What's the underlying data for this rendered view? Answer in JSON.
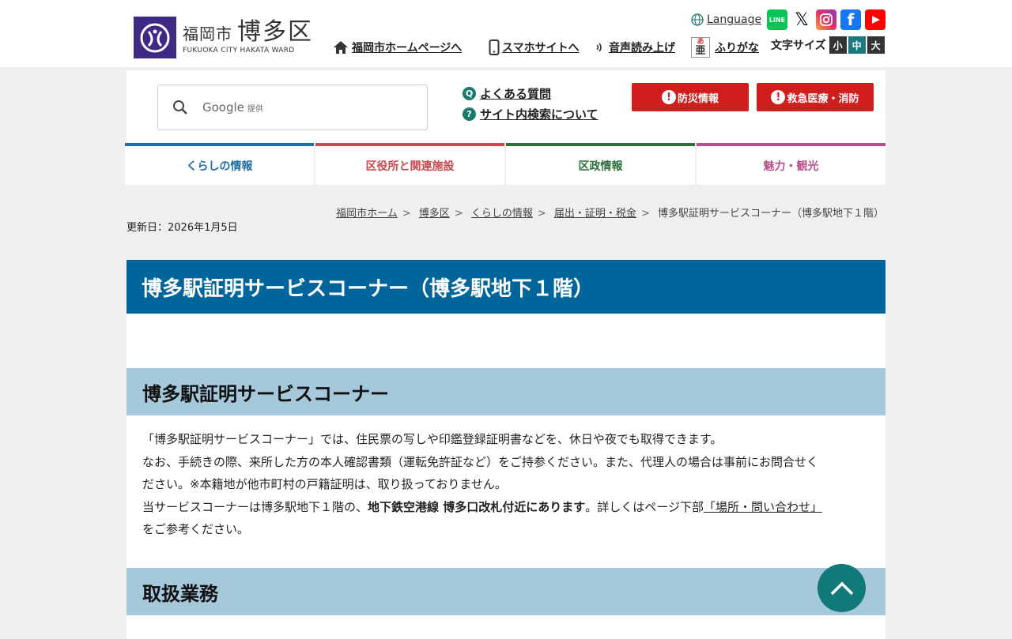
{
  "header": {
    "logo_city": "福岡市",
    "logo_ward": "博多区",
    "logo_en": "FUKUOKA CITY HAKATA WARD",
    "language": "Language",
    "home_link": "福岡市ホームページへ",
    "smartphone_link": "スマホサイトへ",
    "voice_link": "音声読み上げ",
    "furigana_link": "ふりがな",
    "font_size_label": "文字サイズ",
    "font_sizes": [
      "小",
      "中",
      "大"
    ],
    "sns": [
      "LINE",
      "X",
      "Instagram",
      "Facebook",
      "YouTube"
    ]
  },
  "search": {
    "provider": "Google",
    "provider_suffix": "提供",
    "faq": "よくある質問",
    "about_search": "サイト内検索について",
    "disaster_button": "防災情報",
    "emergency_button": "救急医療・消防"
  },
  "global_nav": [
    {
      "label": "くらしの情報",
      "color": "#1f6fa3"
    },
    {
      "label": "区役所と関連施設",
      "color": "#c9474d"
    },
    {
      "label": "区政情報",
      "color": "#2e6e3a"
    },
    {
      "label": "魅力・観光",
      "color": "#b6508a"
    }
  ],
  "breadcrumb": [
    "福岡市ホーム",
    "博多区",
    "くらしの情報",
    "届出・証明・税金"
  ],
  "breadcrumb_current": "博多駅証明サービスコーナー（博多駅地下１階）",
  "updated": "更新日：2026年1月5日",
  "page_title": "博多駅証明サービスコーナー（博多駅地下１階）",
  "section1": {
    "heading": "博多駅証明サービスコーナー",
    "p1": "「博多駅証明サービスコーナー」では、住民票の写しや印鑑登録証明書などを、休日や夜でも取得できます。",
    "p2a": "なお、手続きの際、来所した方の本人確認書類（運転免許証など）をご持参ください。また、代理人の場合は事前にお問合せく",
    "p2b": "ださい。※本籍地が他市町村の戸籍証明は、取り扱っておりません。",
    "p3_pre": "当サービスコーナーは博多駅地下１階の、",
    "p3_bold": "地下鉄空港線 博多口改札付近にあります",
    "p3_mid": "。詳しくはページ下部",
    "p3_link": "「場所・問い合わせ」",
    "p3_post": "をご参考ください。"
  },
  "section2": {
    "heading": "取扱業務"
  },
  "colors": {
    "title_bg": "#00659a",
    "heading_bg": "#a5c8db",
    "alert_red": "#d01e1e",
    "totop": "#0f7a78"
  }
}
